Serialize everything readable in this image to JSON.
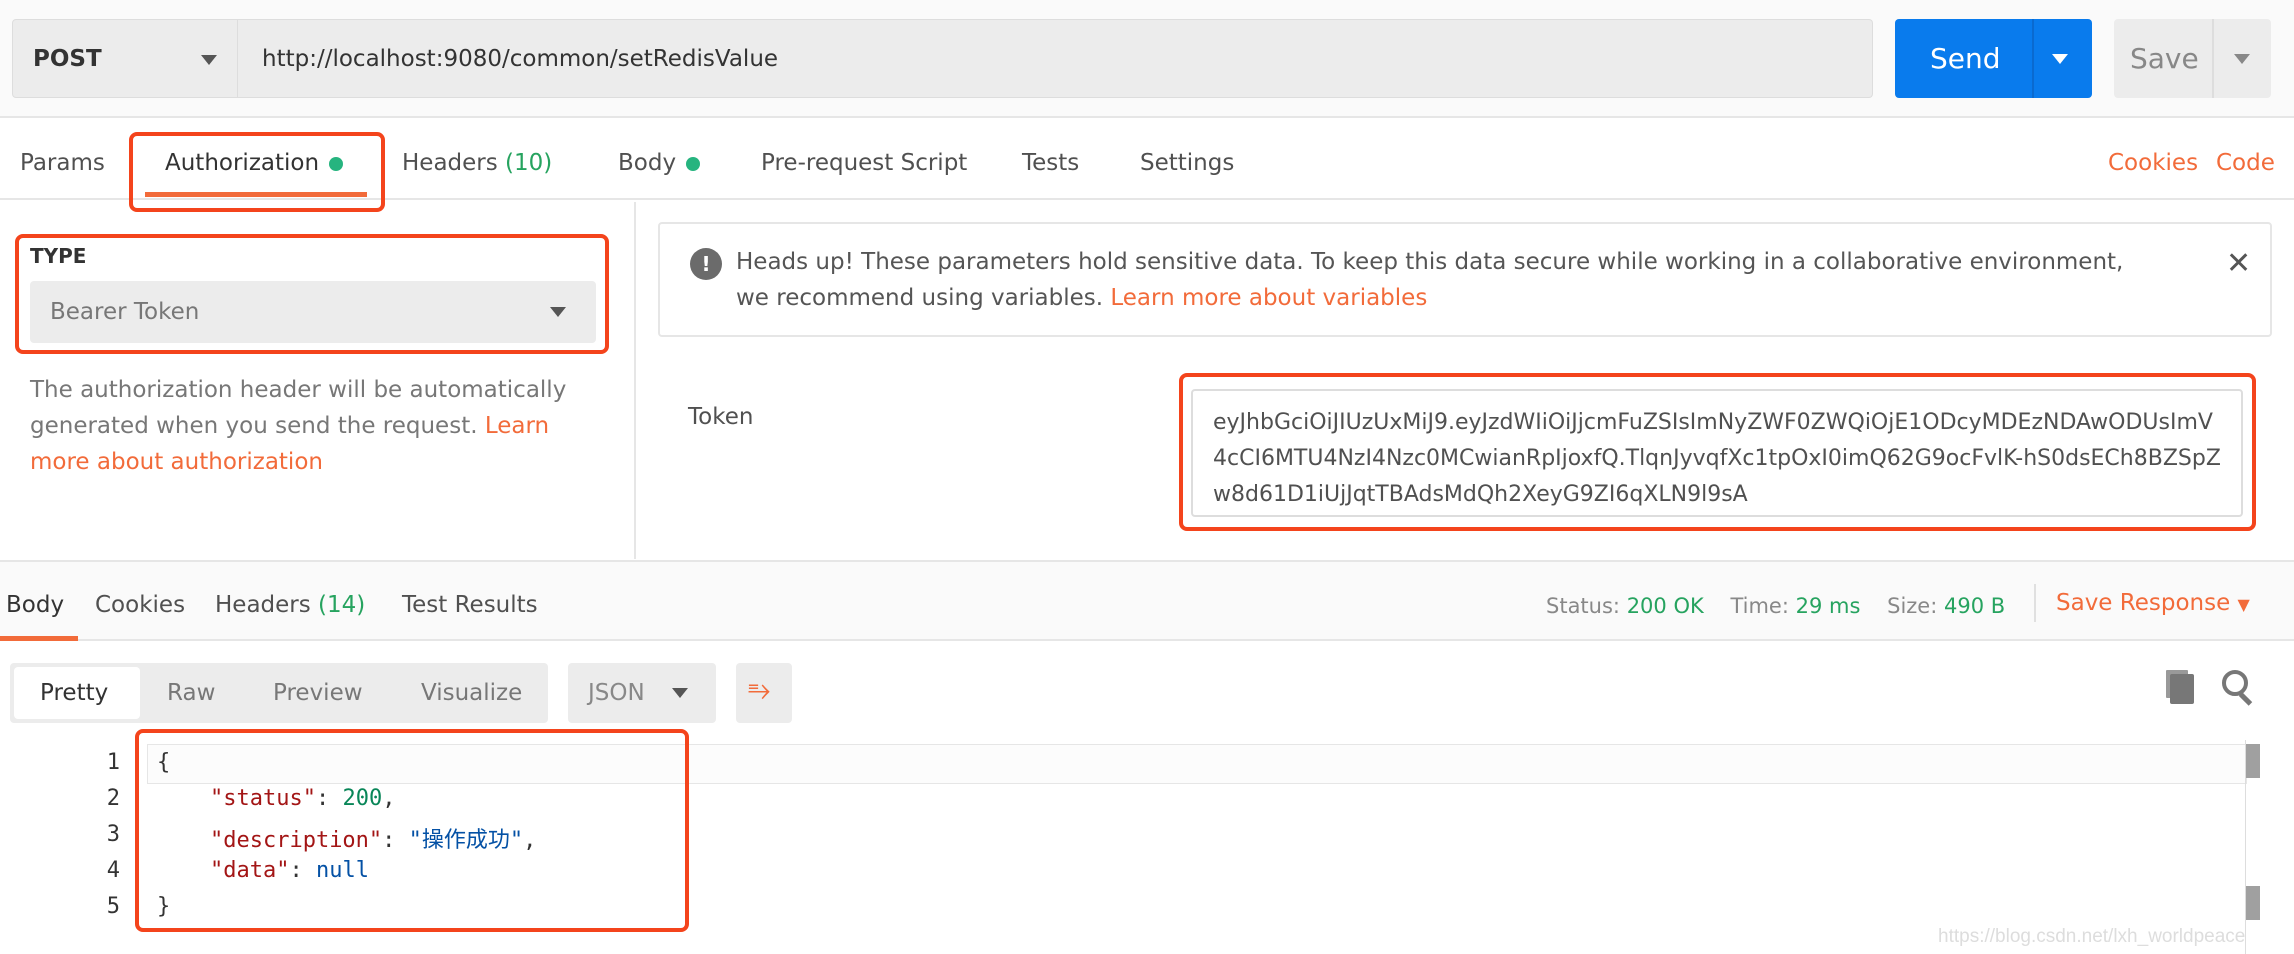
{
  "request": {
    "method": "POST",
    "url": "http://localhost:9080/common/setRedisValue",
    "send_label": "Send",
    "save_label": "Save"
  },
  "tabs": [
    {
      "label": "Params"
    },
    {
      "label": "Authorization",
      "active": true
    },
    {
      "label": "Headers",
      "count": "(10)"
    },
    {
      "label": "Body"
    },
    {
      "label": "Pre-request Script"
    },
    {
      "label": "Tests"
    },
    {
      "label": "Settings"
    }
  ],
  "links": {
    "cookies": "Cookies",
    "code": "Code"
  },
  "auth": {
    "type_label": "TYPE",
    "type_value": "Bearer Token",
    "help_text": "The authorization header will be automatically generated when you send the request.",
    "help_link": "Learn more about authorization"
  },
  "notice": {
    "text": "Heads up! These parameters hold sensitive data. To keep this data secure while working in a collaborative environment, we recommend using variables.",
    "link": "Learn more about variables"
  },
  "token": {
    "label": "Token",
    "value": "eyJhbGciOiJIUzUxMiJ9.eyJzdWIiOiJjcmFuZSIsImNyZWF0ZWQiOjE1ODcyMDEzNDAwODUsImV4cCI6MTU4NzI4Nzc0MCwianRpIjoxfQ.TlqnJyvqfXc1tpOxI0imQ62G9ocFvlK-hS0dsECh8BZSpZw8d61D1iUjJqtTBAdsMdQh2XeyG9ZI6qXLN9l9sA"
  },
  "response": {
    "tabs": [
      {
        "label": "Body"
      },
      {
        "label": "Cookies"
      },
      {
        "label": "Headers",
        "count": "(14)"
      },
      {
        "label": "Test Results"
      }
    ],
    "status_label": "Status:",
    "status": "200 OK",
    "time_label": "Time:",
    "time": "29 ms",
    "size_label": "Size:",
    "size": "490 B",
    "save_response": "Save Response",
    "views": [
      "Pretty",
      "Raw",
      "Preview",
      "Visualize"
    ],
    "format": "JSON",
    "lines": [
      {
        "n": "1"
      },
      {
        "n": "2",
        "key": "\"status\"",
        "val": "200"
      },
      {
        "n": "3",
        "key": "\"description\"",
        "val": "\"操作成功\""
      },
      {
        "n": "4",
        "key": "\"data\"",
        "val": "null"
      },
      {
        "n": "5"
      }
    ],
    "open_brace": "{",
    "close_brace": "}"
  },
  "watermark": "https://blog.csdn.net/lxh_worldpeace",
  "colors": {
    "accent": "#f26b3a",
    "send": "#097bed",
    "success": "#26a35f",
    "highlight": "#f4441c"
  }
}
